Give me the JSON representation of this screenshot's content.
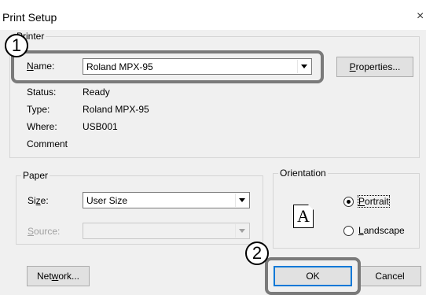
{
  "window": {
    "title": "Print Setup",
    "close_symbol": "×"
  },
  "printer": {
    "group_label": "Printer",
    "name_label": "Name:",
    "name_value": "Roland MPX-95",
    "properties_button": "Properties...",
    "status_label": "Status:",
    "status_value": "Ready",
    "type_label": "Type:",
    "type_value": "Roland MPX-95",
    "where_label": "Where:",
    "where_value": "USB001",
    "comment_label": "Comment",
    "comment_value": ""
  },
  "paper": {
    "group_label": "Paper",
    "size_label": "Size:",
    "size_value": "User Size",
    "source_label": "Source:",
    "source_value": ""
  },
  "orientation": {
    "group_label": "Orientation",
    "icon_letter": "A",
    "portrait_label": "Portrait",
    "landscape_label": "Landscape",
    "selected": "Portrait"
  },
  "buttons": {
    "network": "Network...",
    "ok": "OK",
    "cancel": "Cancel"
  },
  "callouts": [
    "1",
    "2"
  ],
  "colors": {
    "callout_border": "#7a7a7a",
    "dialog_bg": "#f0f0f0",
    "default_button_border": "#0078d7"
  }
}
